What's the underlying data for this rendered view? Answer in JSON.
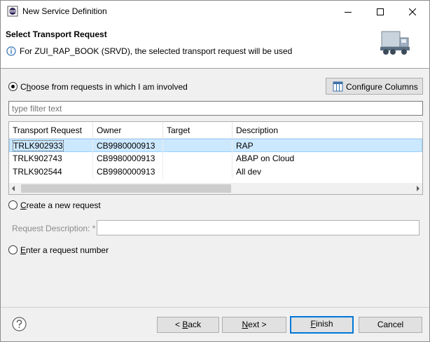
{
  "window": {
    "title": "New Service Definition",
    "controls": [
      "minimize-icon",
      "maximize-icon",
      "close-icon"
    ]
  },
  "header": {
    "title": "Select Transport Request",
    "message": "For ZUI_RAP_BOOK (SRVD), the selected transport request will be used",
    "message_icon": "info-icon",
    "banner_icon": "truck-icon"
  },
  "options": {
    "choose_involved": {
      "label": "Choose from requests in which I am involved",
      "mnemonic": "o",
      "selected": true
    },
    "create_new": {
      "label": "Create a new request",
      "mnemonic": "C",
      "selected": false
    },
    "enter_number": {
      "label": "Enter a request number",
      "mnemonic": "E",
      "selected": false
    }
  },
  "configure_columns": {
    "label": "Configure Columns",
    "icon": "columns-icon"
  },
  "filter": {
    "placeholder": "type filter text",
    "value": ""
  },
  "table": {
    "columns": [
      "Transport Request",
      "Owner",
      "Target",
      "Description"
    ],
    "rows": [
      {
        "request": "TRLK902933",
        "owner": "CB9980000913",
        "target": "",
        "description": "RAP",
        "selected": true
      },
      {
        "request": "TRLK902743",
        "owner": "CB9980000913",
        "target": "",
        "description": "ABAP on Cloud",
        "selected": false
      },
      {
        "request": "TRLK902544",
        "owner": "CB9980000913",
        "target": "",
        "description": "All dev",
        "selected": false
      }
    ]
  },
  "request_description": {
    "label": "Request Description: *",
    "value": ""
  },
  "buttons": {
    "back": "< Back",
    "next": "Next >",
    "finish": "Finish",
    "cancel": "Cancel"
  },
  "colors": {
    "selection": "#cce8ff",
    "default_button_border": "#0078d7"
  }
}
